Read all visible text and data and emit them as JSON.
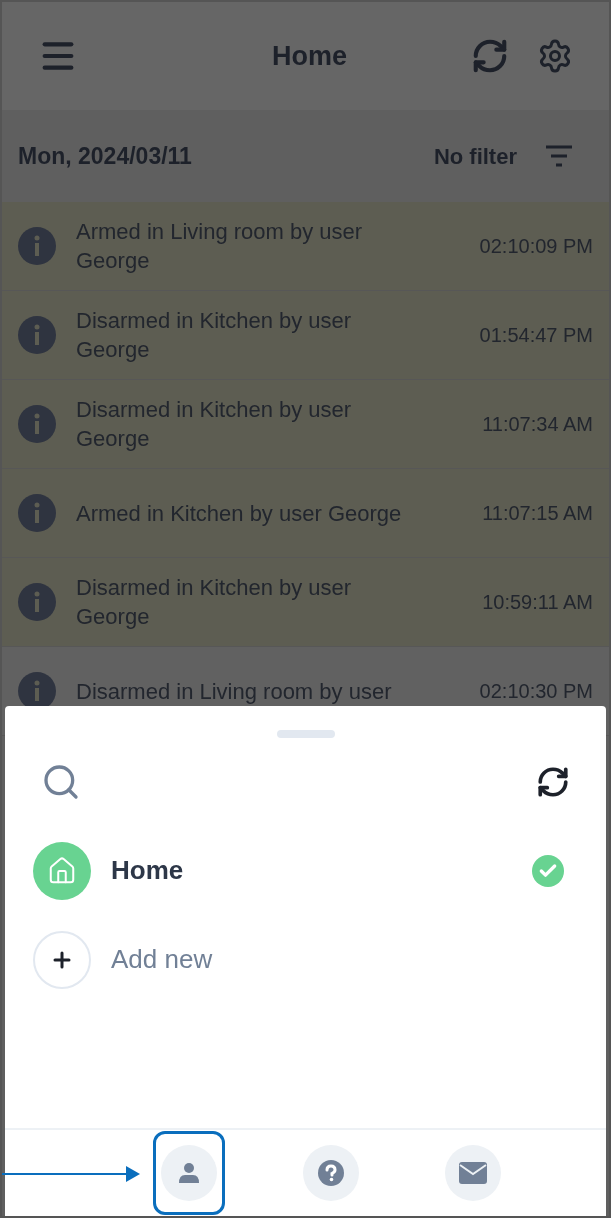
{
  "header": {
    "title": "Home"
  },
  "date_bar": {
    "date": "Mon, 2024/03/11",
    "filter_label": "No filter"
  },
  "events": [
    {
      "message": "Armed in Living room by user George",
      "time": "02:10:09 PM",
      "highlighted": true
    },
    {
      "message": "Disarmed in Kitchen by user George",
      "time": "01:54:47 PM",
      "highlighted": true
    },
    {
      "message": "Disarmed in Kitchen by user George",
      "time": "11:07:34 AM",
      "highlighted": true
    },
    {
      "message": "Armed in Kitchen by user George",
      "time": "11:07:15 AM",
      "highlighted": true
    },
    {
      "message": "Disarmed in Kitchen by user George",
      "time": "10:59:11 AM",
      "highlighted": true
    },
    {
      "message": "Disarmed in Living room by user",
      "time": "02:10:30 PM",
      "highlighted": false
    }
  ],
  "sheet": {
    "homes": [
      {
        "kind": "home",
        "name": "Home",
        "selected": true
      },
      {
        "kind": "add",
        "name": "Add new",
        "selected": false
      }
    ],
    "nav": [
      {
        "kind": "profile",
        "annotated": true
      },
      {
        "kind": "help",
        "annotated": false
      },
      {
        "kind": "mail",
        "annotated": false
      }
    ]
  }
}
